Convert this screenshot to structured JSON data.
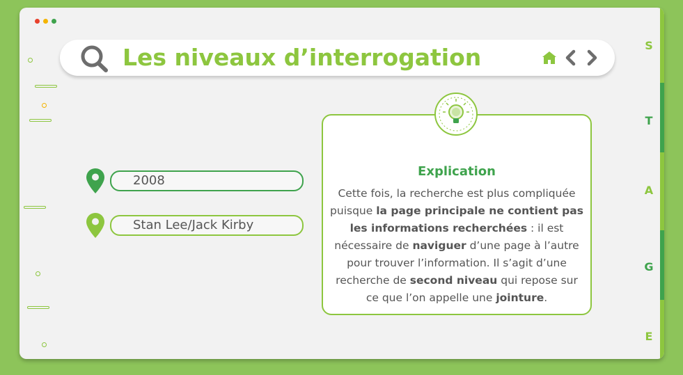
{
  "window": {
    "dots": [
      "#e8412c",
      "#f4b400",
      "#3fa34d"
    ]
  },
  "header": {
    "title": "Les niveaux d’interrogation",
    "icons": [
      "search-icon",
      "home-icon",
      "chevron-left-icon",
      "chevron-right-icon"
    ]
  },
  "sidebar_tabs": [
    {
      "letter": "S",
      "active": false
    },
    {
      "letter": "T",
      "active": true
    },
    {
      "letter": "A",
      "active": false
    },
    {
      "letter": "G",
      "active": true
    },
    {
      "letter": "E",
      "active": false
    }
  ],
  "fields": [
    {
      "value": "2008",
      "pin_icon": "location-pin-icon",
      "pin_color": "#3fa34d"
    },
    {
      "value": "Stan Lee/Jack Kirby",
      "pin_icon": "location-pin-icon",
      "pin_color": "#8dc63f"
    }
  ],
  "explanation": {
    "icon": "lightbulb-icon",
    "title": "Explication",
    "segments": [
      {
        "text": "Cette fois, la recherche est plus compliquée puisque ",
        "bold": false
      },
      {
        "text": "la page principale ne contient pas les informations recherchées",
        "bold": true
      },
      {
        "text": " : il est nécessaire de ",
        "bold": false
      },
      {
        "text": "naviguer",
        "bold": true
      },
      {
        "text": " d’une page à l’autre pour trouver l’information. Il s’agit d’une recherche de ",
        "bold": false
      },
      {
        "text": "second niveau",
        "bold": true
      },
      {
        "text": " qui repose sur ce que l’on appelle une ",
        "bold": false
      },
      {
        "text": "jointure",
        "bold": true
      },
      {
        "text": ".",
        "bold": false
      }
    ]
  },
  "colors": {
    "background": "#8dc45a",
    "accent": "#8dc63f",
    "dark_green": "#3fa34d",
    "icon_grey": "#6d6d6d"
  }
}
